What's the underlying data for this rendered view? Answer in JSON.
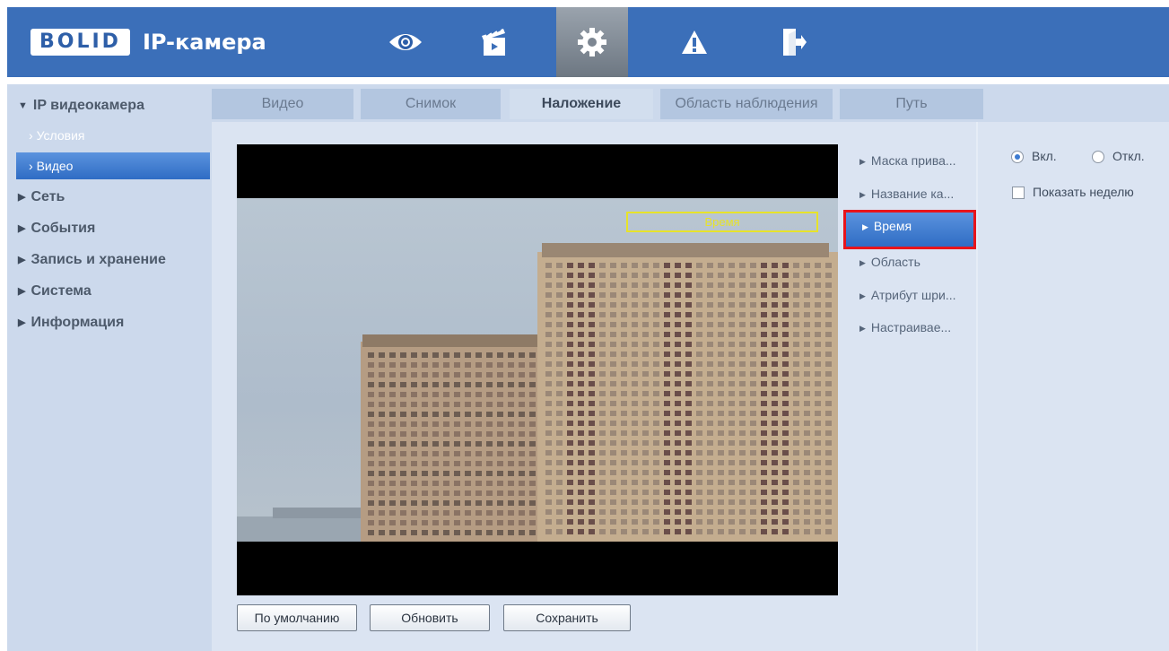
{
  "header": {
    "logo_brand": "BOLID",
    "logo_text": "IP-камера",
    "nav": [
      {
        "icon": "eye-icon",
        "active": false
      },
      {
        "icon": "clapperboard-icon",
        "active": false
      },
      {
        "icon": "gear-icon",
        "active": true
      },
      {
        "icon": "warning-icon",
        "active": false
      },
      {
        "icon": "logout-icon",
        "active": false
      }
    ]
  },
  "sidebar": {
    "root_label": "IP видеокамера",
    "sub_items": [
      "Условия",
      "Видео"
    ],
    "active_sub": "Видео",
    "items": [
      "Сеть",
      "События",
      "Запись и хранение",
      "Система",
      "Информация"
    ]
  },
  "tabs": [
    "Видео",
    "Снимок",
    "Наложение",
    "Область наблюдения",
    "Путь"
  ],
  "active_tab": "Наложение",
  "preview": {
    "overlay_time_label": "Время"
  },
  "overlay_list": [
    "Маска прива...",
    "Название ка...",
    "Время",
    "Область",
    "Атрибут шри...",
    "Настраивае..."
  ],
  "active_overlay": "Время",
  "options": {
    "on_label": "Вкл.",
    "off_label": "Откл.",
    "selected": "on",
    "show_week_label": "Показать неделю",
    "show_week_checked": false
  },
  "buttons": {
    "default_label": "По умолчанию",
    "refresh_label": "Обновить",
    "save_label": "Сохранить"
  },
  "colors": {
    "header_bg": "#3b6fb9",
    "active_blue": "#2f6cc4",
    "highlight_red": "#e8141b",
    "time_box_yellow": "#e7e32a"
  }
}
